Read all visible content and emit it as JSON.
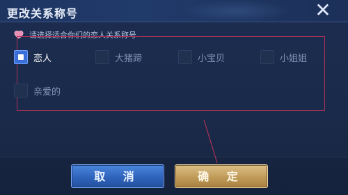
{
  "dialog": {
    "title": "更改关系称号",
    "hint": "请选择适合你们的恋人关系称号"
  },
  "options": [
    {
      "label": "恋人",
      "checked": true
    },
    {
      "label": "大猪蹄",
      "checked": false
    },
    {
      "label": "小宝贝",
      "checked": false
    },
    {
      "label": "小姐姐",
      "checked": false
    },
    {
      "label": "亲爱的",
      "checked": false
    }
  ],
  "buttons": {
    "cancel": "取 消",
    "confirm": "确 定"
  },
  "icons": {
    "close": "close-icon",
    "hint": "heart-icon"
  },
  "colors": {
    "annotation": "#b03058",
    "accent_blue": "#3b6fd8",
    "accent_gold": "#c09b58"
  }
}
